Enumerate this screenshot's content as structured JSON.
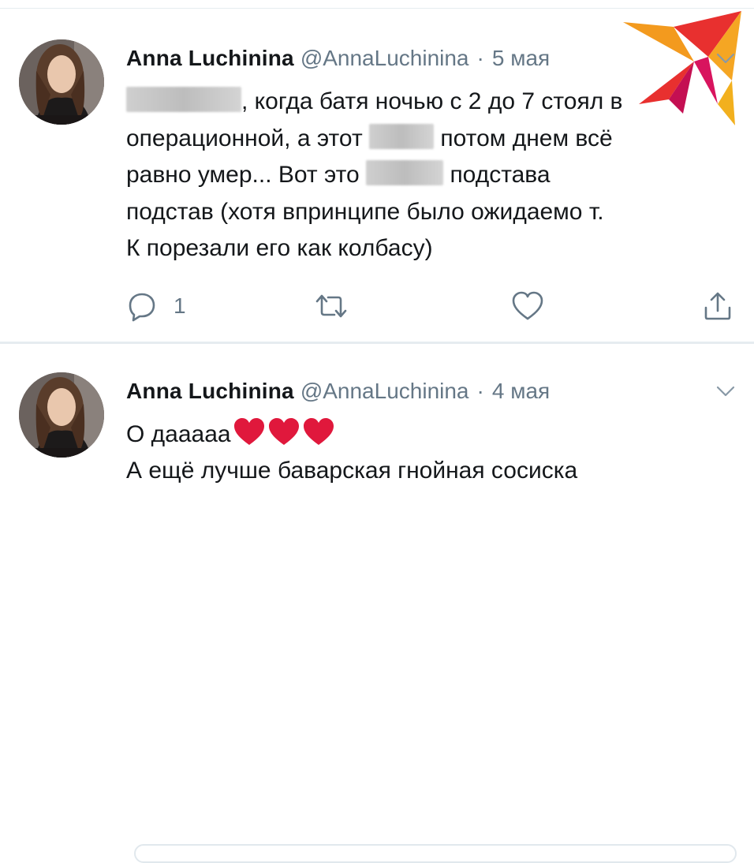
{
  "tweets": [
    {
      "author_name": "Anna Luchinina",
      "handle": "@AnnaLuchinina",
      "separator": "·",
      "date": "5 мая",
      "lines": [
        ", когда батя  ночью с 2 до 7 стоял в",
        "операционной, а этот",
        "потом днем всё",
        "равно умер... Вот это",
        "подстава",
        "подстав (хотя впринципе было ожидаемо т.",
        "К порезали его как колбасу)"
      ],
      "reply_count": "1"
    },
    {
      "author_name": "Anna Luchinina",
      "handle": "@AnnaLuchinina",
      "separator": "·",
      "date": "4 мая",
      "lines": [
        "О дааааа",
        "А ещё лучше баварская гнойная сосиска"
      ]
    }
  ],
  "icons": {
    "reply": "reply-icon",
    "retweet": "retweet-icon",
    "like": "heart-icon",
    "share": "share-icon",
    "more": "chevron-down-icon",
    "emoji": "red-heart-emoji",
    "watermark": "bird-logo"
  },
  "colors": {
    "text": "#14171a",
    "secondary": "#657786",
    "border": "#e6ecf0",
    "heart_emoji": "#e0183c",
    "logo_orange": "#f39a1e",
    "logo_red": "#e8302f",
    "logo_pink": "#d8145e"
  }
}
